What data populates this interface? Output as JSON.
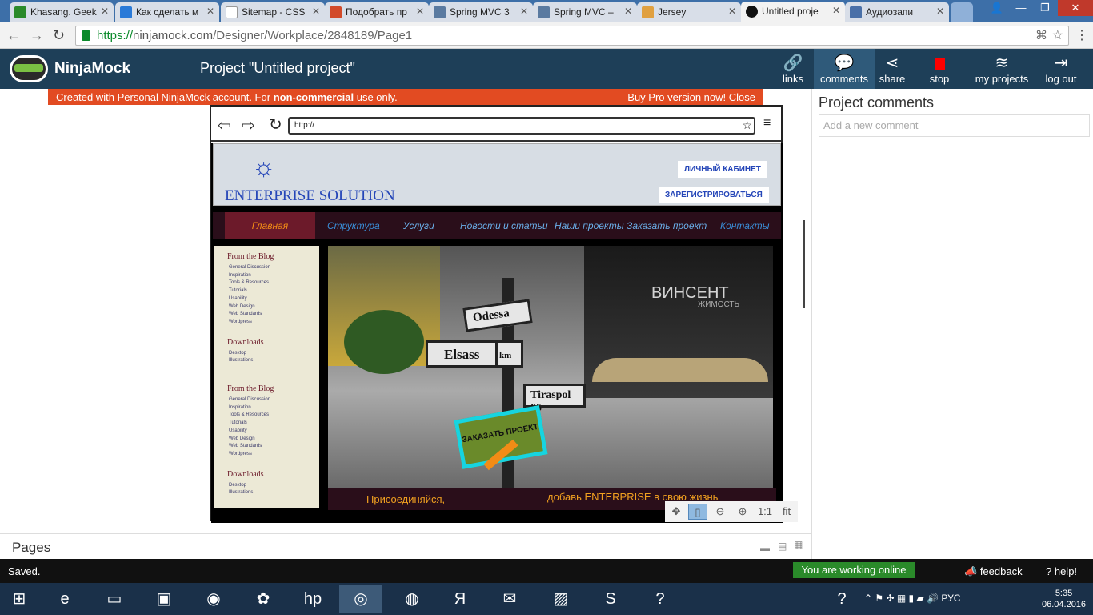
{
  "tabs": [
    {
      "label": "Khasang. Geek",
      "color": "#2a8a2a"
    },
    {
      "label": "Как сделать м",
      "color": "#2a7ad8"
    },
    {
      "label": "Sitemap - CSS",
      "color": "#ffffff"
    },
    {
      "label": "Подобрать пр",
      "color": "#d24a2a"
    },
    {
      "label": "Spring MVC 3",
      "color": "#5a7aa0"
    },
    {
      "label": "Spring MVC –",
      "color": "#5a7aa0"
    },
    {
      "label": "Jersey",
      "color": "#e0a040"
    },
    {
      "label": "Untitled proje",
      "color": "#111111"
    },
    {
      "label": "Аудиозапи",
      "color": "#4a70a8"
    }
  ],
  "address": {
    "scheme": "https://",
    "host": "ninjamock.com",
    "path": "/Designer/Workplace/2848189/Page1"
  },
  "header": {
    "brand": "NinjaMock",
    "project_title": "Project \"Untitled project\""
  },
  "toolbar": [
    {
      "label": "links",
      "icon": "link-icon"
    },
    {
      "label": "comments",
      "icon": "comments-icon"
    },
    {
      "label": "share",
      "icon": "share-icon"
    },
    {
      "label": "stop",
      "icon": "stop-icon"
    },
    {
      "label": "my projects",
      "icon": "layers-icon"
    },
    {
      "label": "log out",
      "icon": "logout-icon"
    }
  ],
  "notice": {
    "text_before": "Created with Personal NinjaMock account. For ",
    "bold": "non-commercial",
    "text_after": " use only.",
    "buy": "Buy Pro version now!",
    "close": "Close"
  },
  "mock_browser": {
    "url": "http://"
  },
  "site": {
    "title": "ENTERPRISE SOLUTION",
    "btn_cabinet": "ЛИЧНЫЙ КАБИНЕТ",
    "btn_register": "ЗАРЕГИСТРИРОВАТЬСЯ",
    "menu": [
      "Главная",
      "Структура",
      "Услуги",
      "Новости и статьи",
      "Наши проекты",
      "Заказать проект",
      "Контакты"
    ],
    "sidebar": [
      {
        "heading": "From the Blog",
        "links": [
          "General Discussion",
          "Inspiration",
          "Tools & Resources",
          "Tutorials",
          "Usability",
          "Web Design",
          "Web Standards",
          "Wordpress"
        ]
      },
      {
        "heading": "Downloads",
        "links": [
          "Desktop",
          "Illustrations"
        ]
      },
      {
        "heading": "From the Blog",
        "links": [
          "General Discussion",
          "Inspiration",
          "Tools & Resources",
          "Tutorials",
          "Usability",
          "Web Design",
          "Web Standards",
          "Wordpress"
        ]
      },
      {
        "heading": "Downloads",
        "links": [
          "Desktop",
          "Illustrations"
        ]
      }
    ],
    "signs": [
      "Odessa",
      "Elsass",
      "km",
      "Tiraspol 65"
    ],
    "sticker": "ЗАКАЗАТЬ ПРОЕКТ",
    "watermark": "ВИНСЕНТ",
    "watermark_sub": "ЖИМОСТЬ",
    "banner_left": "Присоединяйся,",
    "banner_right": "добавь ENTERPRISE в свою жизнь"
  },
  "zoom": {
    "fit": "fit",
    "one": "1:1"
  },
  "comments": {
    "title": "Project comments",
    "placeholder": "Add a new comment"
  },
  "pages": {
    "label": "Pages"
  },
  "status": {
    "saved": "Saved.",
    "online": "You are working online",
    "feedback": "feedback",
    "help": "help!"
  },
  "tray": {
    "lang": "РУС",
    "time": "5:35",
    "date": "06.04.2016"
  }
}
